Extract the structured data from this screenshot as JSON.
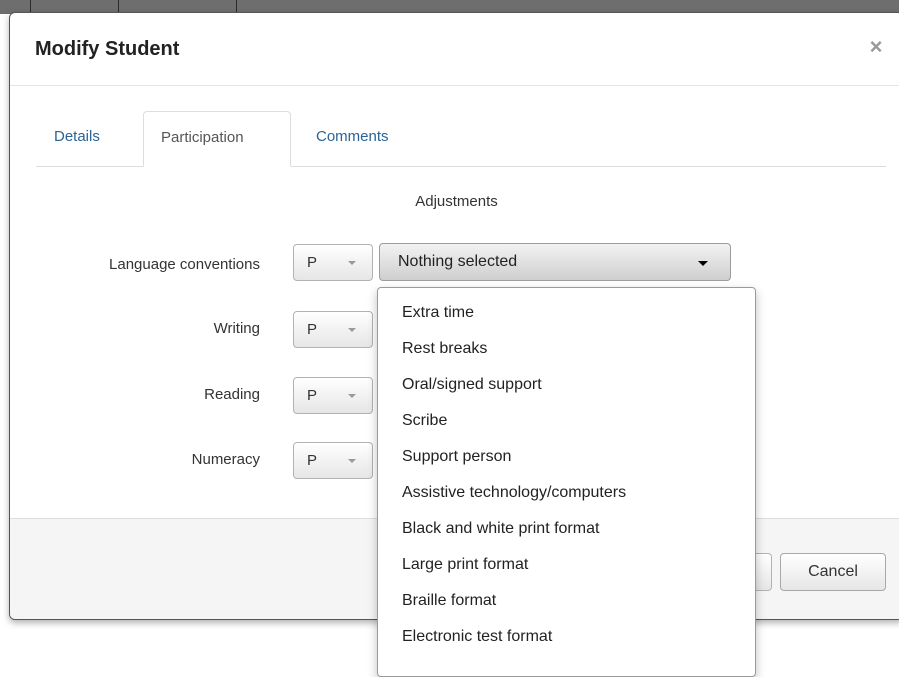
{
  "modal": {
    "title": "Modify Student",
    "close_label": "×"
  },
  "tabs": [
    {
      "label": "Details",
      "active": false
    },
    {
      "label": "Participation",
      "active": true
    },
    {
      "label": "Comments",
      "active": false
    }
  ],
  "participation": {
    "section_heading": "Adjustments",
    "rows": [
      {
        "label": "Language conventions",
        "code": "P"
      },
      {
        "label": "Writing",
        "code": "P"
      },
      {
        "label": "Reading",
        "code": "P"
      },
      {
        "label": "Numeracy",
        "code": "P"
      }
    ],
    "adjustments_select": {
      "value": "Nothing selected",
      "options": [
        "Extra time",
        "Rest breaks",
        "Oral/signed support",
        "Scribe",
        "Support person",
        "Assistive technology/computers",
        "Black and white print format",
        "Large print format",
        "Braille format",
        "Electronic test format"
      ]
    }
  },
  "footer": {
    "cancel_label": "Cancel"
  },
  "colors": {
    "link": "#2a6496",
    "footer_bg": "#f5f5f5",
    "border": "#dddddd"
  }
}
